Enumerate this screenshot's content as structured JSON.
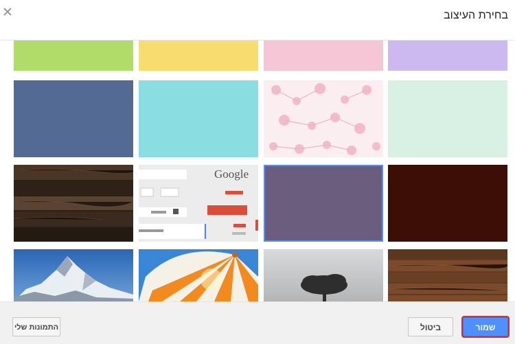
{
  "dialog": {
    "title": "בחירת העיצוב",
    "close_icon": "close-icon"
  },
  "themes": [
    {
      "name": "green",
      "color": "#b0dc6a"
    },
    {
      "name": "yellow",
      "color": "#f7dd70"
    },
    {
      "name": "pink",
      "color": "#f5c6d6"
    },
    {
      "name": "lavender",
      "color": "#cbb9ef"
    },
    {
      "name": "slate-blue",
      "color": "#536a95"
    },
    {
      "name": "aqua",
      "color": "#8adde0"
    },
    {
      "name": "cherry-blossom",
      "color": "#f7dde3"
    },
    {
      "name": "mint",
      "color": "#d9f1e3"
    },
    {
      "name": "dark-wood",
      "color": "#3b2b1e"
    },
    {
      "name": "google-classic",
      "color": "#f0f0f0"
    },
    {
      "name": "muted-purple",
      "color": "#695c7c",
      "selected": true
    },
    {
      "name": "maroon",
      "color": "#3d0e06"
    },
    {
      "name": "mountain",
      "color": "#2c6ab1"
    },
    {
      "name": "umbrella",
      "color": "#f79a2c"
    },
    {
      "name": "tree",
      "color": "#bdbdbd"
    },
    {
      "name": "wood-planks",
      "color": "#7a4a2a"
    }
  ],
  "google_tile": {
    "logo_text": "Google"
  },
  "footer": {
    "save_label": "שמור",
    "cancel_label": "ביטול",
    "my_photos_label": "התמונות שלי"
  }
}
